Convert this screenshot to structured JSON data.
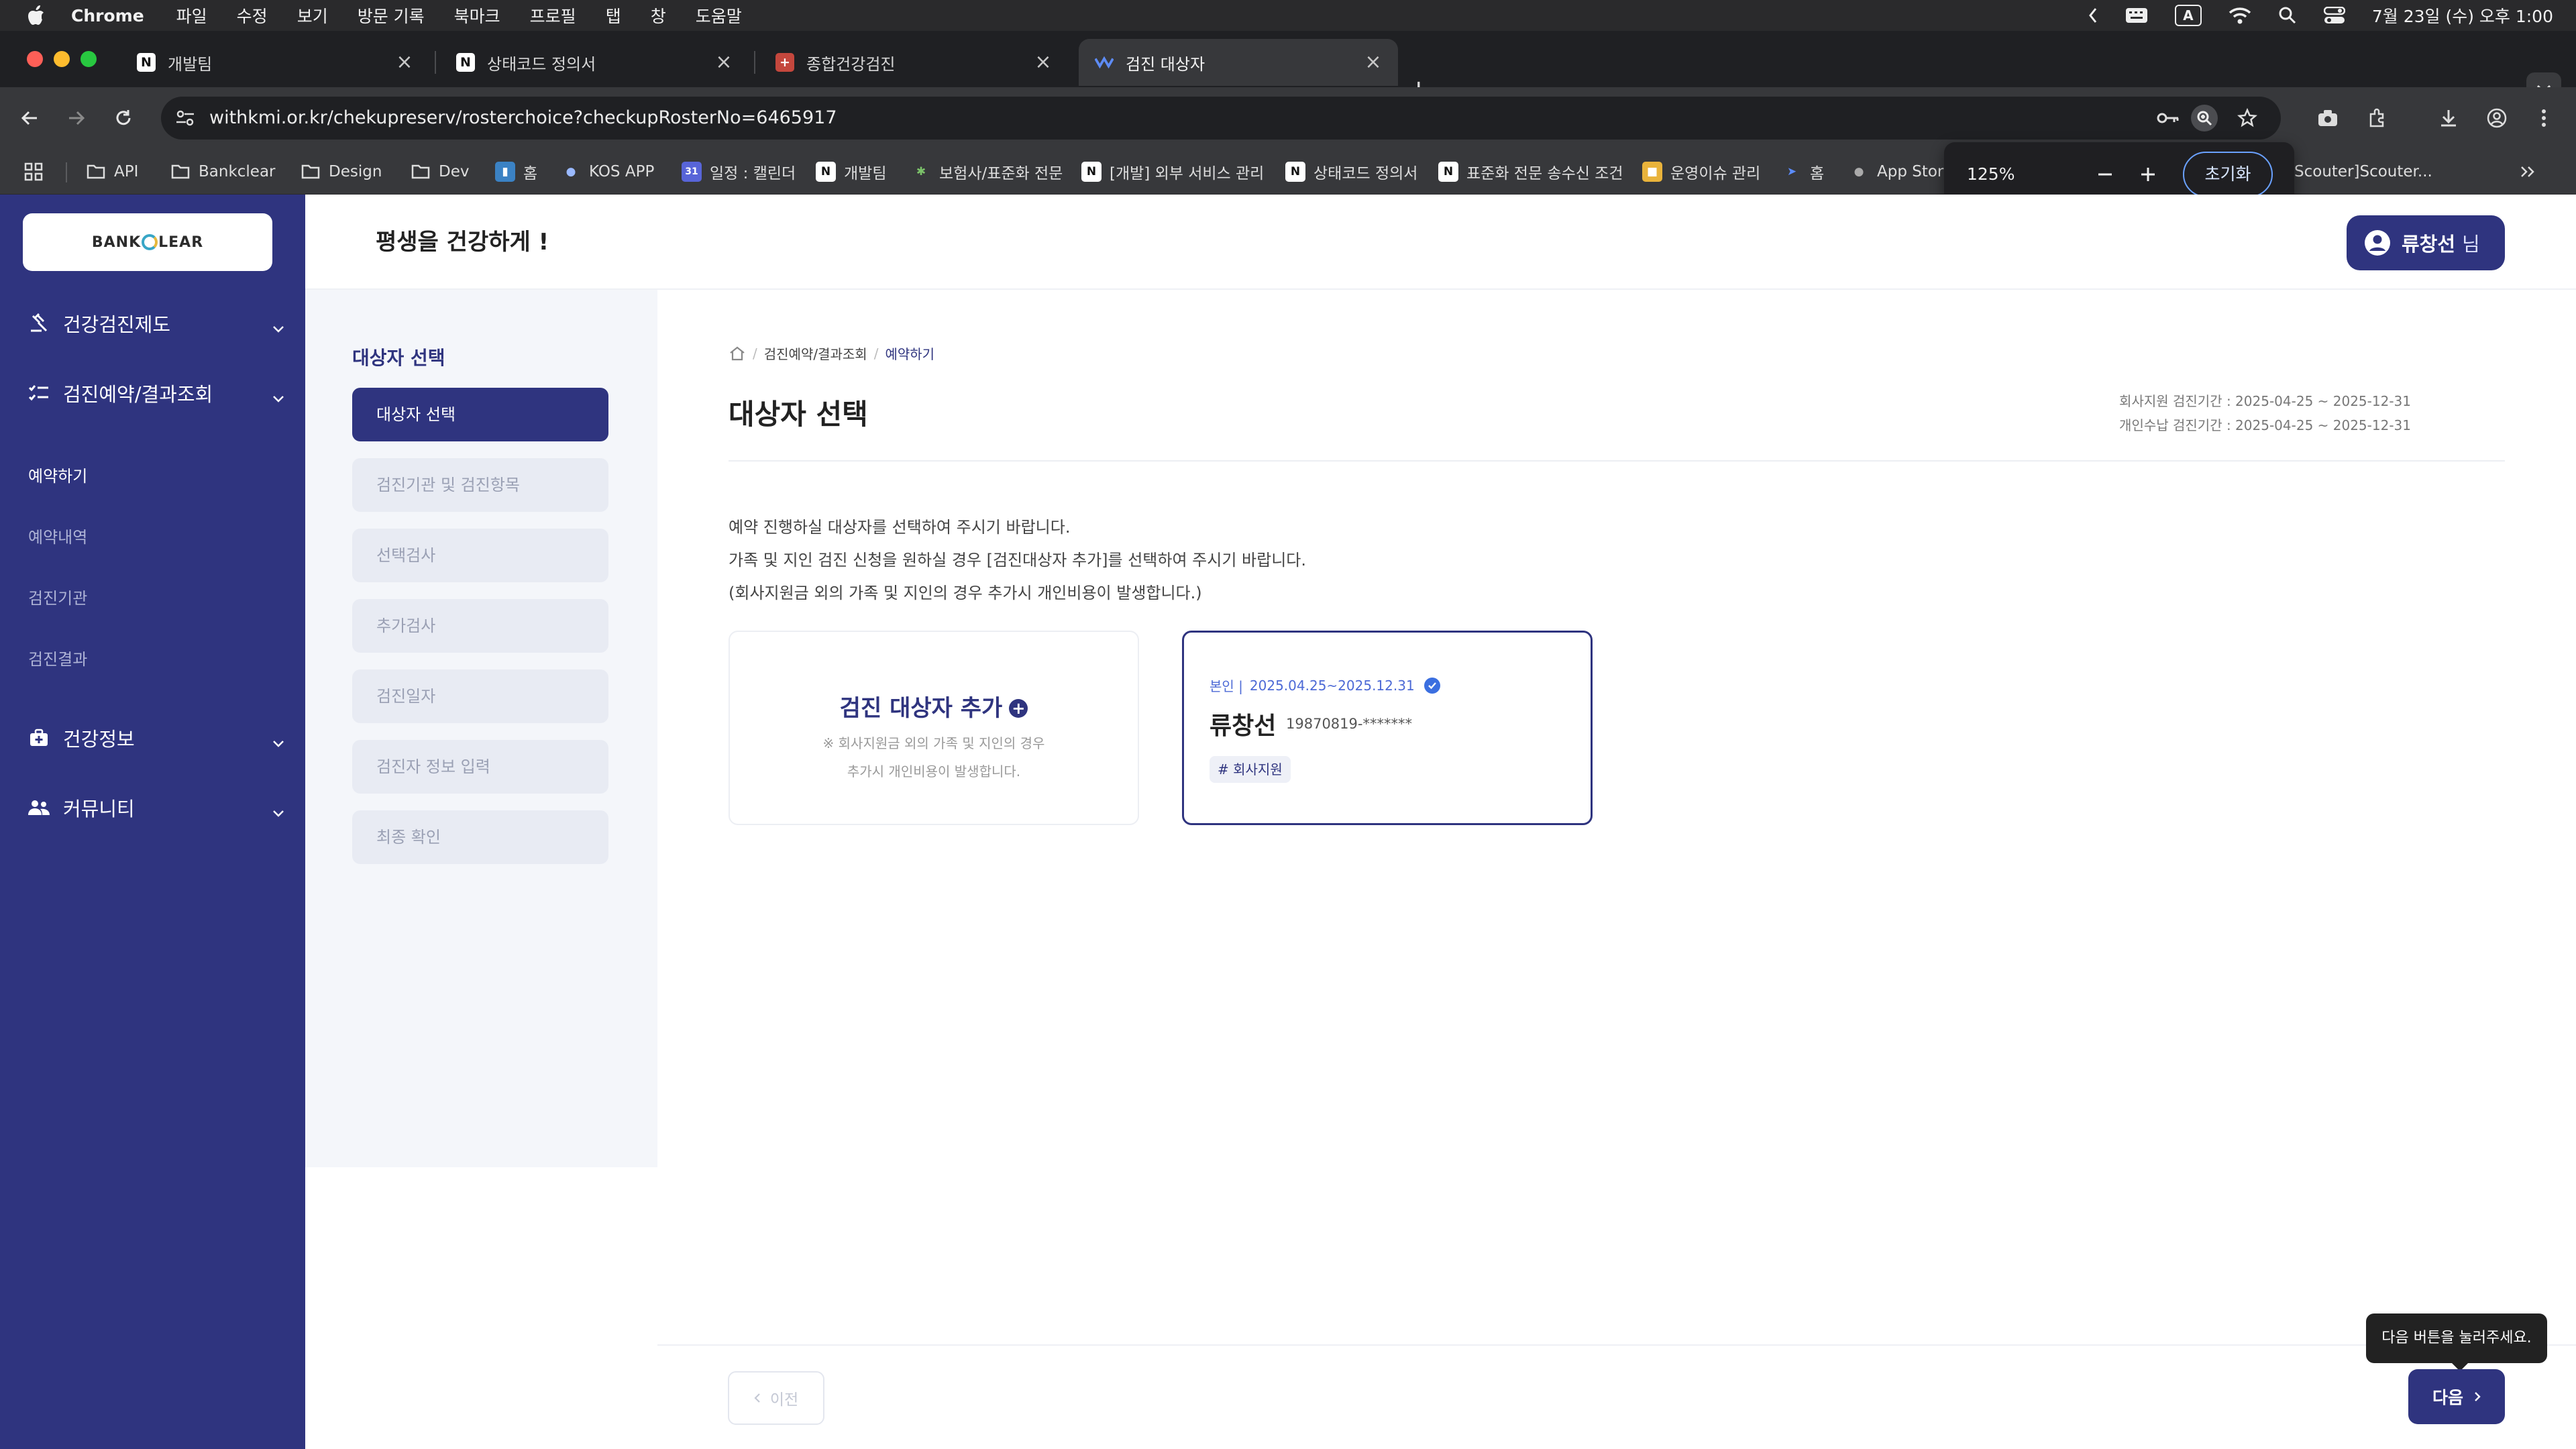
{
  "menubar": {
    "app": "Chrome",
    "items": [
      "파일",
      "수정",
      "보기",
      "방문 기록",
      "북마크",
      "프로필",
      "탭",
      "창",
      "도움말"
    ],
    "clock": "7월 23일 (수) 오후 1:00",
    "input_mode": "A"
  },
  "tabs": [
    {
      "title": "개발팀",
      "icon": "notion-icon"
    },
    {
      "title": "상태코드 정의서",
      "icon": "notion-icon"
    },
    {
      "title": "종합건강검진",
      "icon": "hospital-icon"
    },
    {
      "title": "검진 대상자",
      "icon": "kmi-icon",
      "active": true
    }
  ],
  "omnibox": {
    "url": "withkmi.or.kr/chekupreserv/rosterchoice?checkupRosterNo=6465917"
  },
  "bookmarks": [
    {
      "label": "API",
      "icon": "folder-icon"
    },
    {
      "label": "Bankclear",
      "icon": "folder-icon"
    },
    {
      "label": "Design",
      "icon": "folder-icon"
    },
    {
      "label": "Dev",
      "icon": "folder-icon"
    },
    {
      "label": "홈",
      "icon": "bookmark-icon"
    },
    {
      "label": "KOS APP",
      "icon": "bookmark-icon"
    },
    {
      "label": "일정 : 캘린더",
      "icon": "calendar-icon"
    },
    {
      "label": "개발팀",
      "icon": "notion-icon"
    },
    {
      "label": "보험사/표준화 전문",
      "icon": "bookmark-icon"
    },
    {
      "label": "[개발] 외부 서비스 관리",
      "icon": "notion-icon"
    },
    {
      "label": "상태코드 정의서",
      "icon": "notion-icon"
    },
    {
      "label": "표준화 전문 송수신 조건",
      "icon": "notion-icon"
    },
    {
      "label": "운영이슈 관리",
      "icon": "bookmark-icon"
    },
    {
      "label": "홈",
      "icon": "bookmark-icon"
    },
    {
      "label": "App Stor",
      "icon": "apple-icon"
    },
    {
      "label": "Scouter]Scouter...",
      "icon": "bookmark-icon"
    }
  ],
  "zoom_popup": {
    "value": "125%",
    "reset_label": "초기화"
  },
  "sidebar": {
    "logo": {
      "pre": "BANK",
      "post": "LEAR"
    },
    "main": [
      {
        "label": "건강검진제도",
        "icon": "gavel-icon"
      },
      {
        "label": "검진예약/결과조회",
        "icon": "checklist-icon"
      },
      {
        "label": "건강정보",
        "icon": "medical-bag-icon"
      },
      {
        "label": "커뮤니티",
        "icon": "people-icon"
      }
    ],
    "sub": [
      "예약하기",
      "예약내역",
      "검진기관",
      "검진결과"
    ]
  },
  "header": {
    "slogan": "평생을 건강하게 !",
    "user_name": "류창선",
    "user_suffix": "님"
  },
  "steps": {
    "title": "대상자 선택",
    "items": [
      "대상자 선택",
      "검진기관 및 검진항목",
      "선택검사",
      "추가검사",
      "검진일자",
      "검진자 정보 입력",
      "최종 확인"
    ]
  },
  "content": {
    "breadcrumb": [
      "검진예약/결과조회",
      "예약하기"
    ],
    "title": "대상자 선택",
    "period_company": "회사지원 검진기간 : 2025-04-25 ~ 2025-12-31",
    "period_personal": "개인수납 검진기간 : 2025-04-25 ~ 2025-12-31",
    "guide": [
      "예약 진행하실 대상자를 선택하여 주시기 바랍니다.",
      "가족 및 지인 검진 신청을 원하실 경우 [검진대상자 추가]를 선택하여 주시기 바랍니다.",
      "(회사지원금 외의 가족 및 지인의 경우 추가시 개인비용이 발생합니다.)"
    ],
    "add_card": {
      "title": "검진 대상자 추가",
      "note1": "※ 회사지원금 외의 가족 및 지인의 경우",
      "note2": "추가시 개인비용이 발생합니다."
    },
    "person_card": {
      "relation": "본인 |",
      "period": "2025.04.25~2025.12.31",
      "name": "류창선",
      "birth": "19870819-*******",
      "tag": "# 회사지원"
    }
  },
  "footer": {
    "prev_label": "이전",
    "next_label": "다음",
    "tooltip": "다음 버튼을 눌러주세요."
  }
}
